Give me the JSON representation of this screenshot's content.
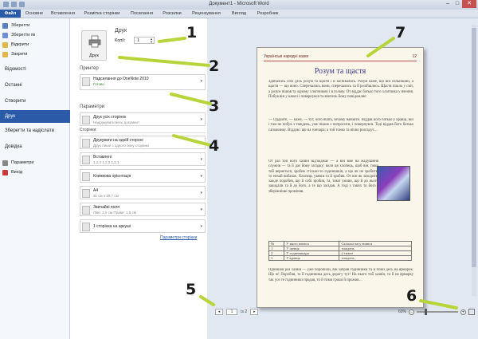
{
  "titlebar": {
    "title": "Документ1 - Microsoft Word",
    "minimize": "–",
    "maximize": "□",
    "close": "✕"
  },
  "tabs": [
    "Файл",
    "Основне",
    "Вставлення",
    "Розмітка сторінки",
    "Посилання",
    "Розсилки",
    "Рецензування",
    "Вигляд",
    "Розробник"
  ],
  "nav": {
    "save": "Зберегти",
    "save_as": "Зберегти як",
    "open": "Відкрити",
    "close": "Закрити",
    "info": "Відомості",
    "recent": "Останні",
    "new": "Створити",
    "print": "Друк",
    "save_send": "Зберегти та надіслати",
    "help": "Довідка",
    "options": "Параметри",
    "exit": "Вихід"
  },
  "print": {
    "heading": "Друк",
    "copies_label": "Копії:",
    "copies_value": "1",
    "print_button": "Друк",
    "printer_heading": "Принтер",
    "printer_name": "Надсилання до OneNote 2010",
    "printer_status": "Готово",
    "params_heading": "Параметри",
    "range_main": "Друк усіх сторінок",
    "range_sub": "Надрукувати весь документ",
    "pages_label": "Сторінки:",
    "sides_main": "Друкувати на одній стороні",
    "sides_sub": "Друк лише з одного боку сторінки",
    "collate_main": "Вставлені",
    "collate_sub": "1,2,3    1,2,3    1,2,3",
    "orient_main": "Книжкова орієнтація",
    "size_main": "A4",
    "size_sub": "21 см x 29,7 см",
    "margins_main": "Звичайні поля",
    "margins_sub": "Ліве: 2,5 см   Праве: 1,5 см",
    "pps_main": "1 сторінка на аркуші",
    "page_setup_link": "Параметри сторінки"
  },
  "preview": {
    "header_left": "Українські народні казки",
    "header_right": "12",
    "title": "Розум та щастя",
    "para1": "Здибались собі десь розум та щастя і й заспівались. Розум каже, що він сильніший, а щастя — що воно. Сперечались вони, сперечались та й розійшлись. Щастя пішло у світ, а розум пішов та одному хлопчикові і в голову. От віддає батько того хлопчика у вчення. Побув він у школі і повернувся та вчитель йому повідомляє:",
    "para2": "— Оддайте, — каже, — тут, чого вчать, нічому навчити. Віддав його батько у кравці, він і там не побув з тиждень, уже пішов з попросити, і повернувся. Тоді віддав його батько сапожнику. Віддав і ще на гончара; а той тонко та вічно розгадує…",
    "para3": "От раз той його хазяїн від'їжджає — а він вже на жадування служив — та й дає йому загадку: коли ця хлопець, щоб він, поки той вернеться, зробив стільки-то годинників, а що як не зробить, то нехай вибачає. Хлопець узявся та й зробив. От він як заходить, зажде поробив, що й собі зробив, та, такої умови, що й до нього закидали та й до його, а те що засідав. А тоді з таких то його і зберіжніше проміняв.",
    "para4": "Прийшов раз хазяїн — уже поробили, він забрав годинники та й повіз десь на ярмарок. Що ж! Поробив, та й годинника десь дорогу тут! На нього той хазяїн, та й на ярмарку так усе те годинники продав, то й тими гроші й прожив…",
    "table": [
      [
        "№",
        "У якого вчився",
        "Скільки часу вчився"
      ],
      [
        "1",
        "У шевця",
        "тиждень"
      ],
      [
        "2",
        "У годинникаря",
        "2 тижні"
      ],
      [
        "3",
        "У кравця",
        "тиждень"
      ]
    ],
    "page_current": "1",
    "page_total": "із 2",
    "zoom_level": "60%"
  },
  "annotations": [
    "1",
    "2",
    "3",
    "4",
    "5",
    "6",
    "7"
  ],
  "colors": {
    "accent": "#2a5aa8",
    "arrow": "#b7d53a",
    "page_bg": "#fbf6ea",
    "title_color": "#3a3a8a"
  }
}
